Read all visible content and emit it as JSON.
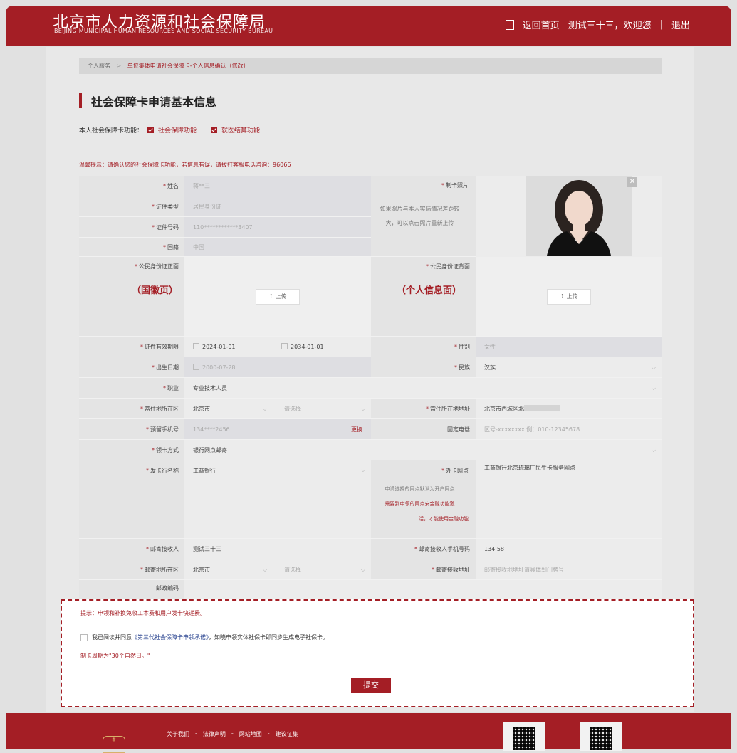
{
  "header": {
    "title_cn": "北京市人力资源和社会保障局",
    "title_en": "BEIJING MUNICIPAL HUMAN RESOURCES AND SOCIAL SECURITY BUREAU",
    "home_link": "返回首页",
    "welcome": "测试三十三，欢迎您",
    "separator": "|",
    "logout": "退出"
  },
  "breadcrumb": {
    "root": "个人服务",
    "sep": ">",
    "current": "单位集体申请社会保障卡-个人信息确认（修改）"
  },
  "page_title": "社会保障卡申请基本信息",
  "functions": {
    "label": "本人社会保障卡功能：",
    "items": [
      "社会保障功能",
      "就医结算功能"
    ]
  },
  "notice": "温馨提示：请确认您的社会保障卡功能，若信息有误，请拨打客服电话咨询：96066",
  "form": {
    "star": "*",
    "name_label": "姓名",
    "name_value": "蒋**三",
    "id_type_label": "证件类型",
    "id_type_value": "居民身份证",
    "id_no_label": "证件号码",
    "id_no_value": "110************3407",
    "nation_label": "国籍",
    "nation_value": "中国",
    "photo_label": "制卡照片",
    "photo_hint_1": "如果照片与本人实际情况差距较",
    "photo_hint_2": "大，可以点击照片重新上传",
    "photo_close": "✕",
    "id_front_label": "公民身份证正面",
    "id_front_side": "（国徽页）",
    "id_back_label": "公民身份证背面",
    "id_back_side": "（个人信息面）",
    "upload_label": "⇡ 上传",
    "validity_label": "证件有效期限",
    "validity_start": "2024-01-01",
    "validity_end": "2034-01-01",
    "gender_label": "性别",
    "gender_value": "女性",
    "birth_label": "出生日期",
    "birth_value": "2000-07-28",
    "ethnic_label": "民族",
    "ethnic_value": "汉族",
    "job_label": "职业",
    "job_value": "专业技术人员",
    "residence_label": "常住地所在区",
    "residence_city": "北京市",
    "residence_district": "请选择",
    "address_label": "常住所在地地址",
    "address_value": "北京市西城区北",
    "mobile_label": "预留手机号",
    "mobile_value": "134****2456",
    "mobile_edit": "更换",
    "phone_label": "固定电话",
    "phone_placeholder": "区号-xxxxxxxx 例：010-12345678",
    "receive_label": "领卡方式",
    "receive_value": "银行网点邮寄",
    "bank_label": "发卡行名称",
    "bank_value": "工商银行",
    "branch_label": "办卡网点",
    "branch_value": "工商银行北京琉璃厂民生卡服务网点",
    "branch_hint_1": "申请选择的网点默认为开户网点",
    "branch_hint_2": "需要到申领的网点安金融功能激",
    "branch_hint_3": "活，才能使用金融功能",
    "recipient_label": "邮寄接收人",
    "recipient_value": "测试三十三",
    "recipient_phone_label": "邮寄接收人手机号码",
    "recipient_phone_value": "134        58",
    "mail_area_label": "邮寄地所在区",
    "mail_city": "北京市",
    "mail_district": "请选择",
    "mail_addr_label": "邮寄接收地址",
    "mail_addr_placeholder": "邮寄接收地地址请具体到门牌号",
    "postcode_label": "邮政编码"
  },
  "overlay": {
    "tip": "提示：申领和补换免收工本费和用户发卡快递费。",
    "agree_prefix": "我已阅读并同意",
    "agree_link": "《第三代社会保障卡申领承诺》",
    "agree_suffix": "，知晓申领实体社保卡即同步生成电子社保卡。",
    "period": "制卡周期为\"30个自然日。\"",
    "submit": "提交"
  },
  "footer": {
    "links": [
      "关于我们",
      "-",
      "法律声明",
      "-",
      "网站地图",
      "-",
      "建议征集"
    ]
  },
  "colors": {
    "brand": "#a41e25"
  }
}
